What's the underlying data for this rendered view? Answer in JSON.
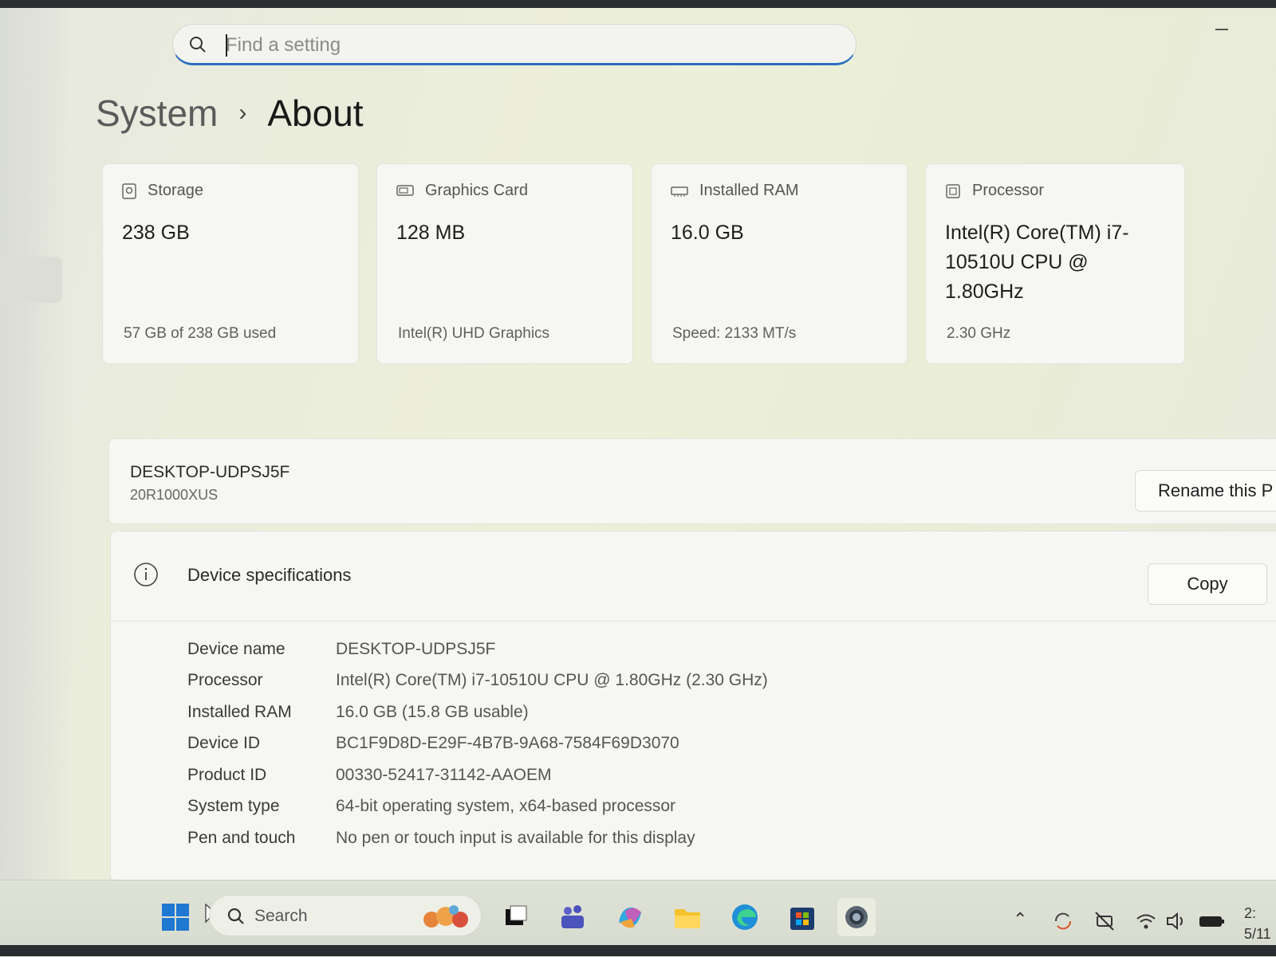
{
  "search": {
    "placeholder": "Find a setting"
  },
  "breadcrumb": {
    "parent": "System",
    "separator": "›",
    "current": "About"
  },
  "cards": [
    {
      "title": "Storage",
      "value": "238 GB",
      "sub": "57 GB of 238 GB used",
      "icon": "storage-icon"
    },
    {
      "title": "Graphics Card",
      "value": "128 MB",
      "sub": "Intel(R) UHD Graphics",
      "icon": "graphics-card-icon"
    },
    {
      "title": "Installed RAM",
      "value": "16.0 GB",
      "sub": "Speed: 2133 MT/s",
      "icon": "ram-icon"
    },
    {
      "title": "Processor",
      "value": "Intel(R) Core(TM) i7-10510U CPU @ 1.80GHz",
      "sub": "2.30 GHz",
      "icon": "processor-icon"
    }
  ],
  "device": {
    "name": "DESKTOP-UDPSJ5F",
    "model": "20R1000XUS",
    "rename_label": "Rename this P"
  },
  "specs": {
    "title": "Device specifications",
    "copy_label": "Copy",
    "rows": [
      {
        "key": "Device name",
        "value": "DESKTOP-UDPSJ5F"
      },
      {
        "key": "Processor",
        "value": "Intel(R) Core(TM) i7-10510U CPU @ 1.80GHz (2.30 GHz)"
      },
      {
        "key": "Installed RAM",
        "value": "16.0 GB (15.8 GB usable)"
      },
      {
        "key": "Device ID",
        "value": "BC1F9D8D-E29F-4B7B-9A68-7584F69D3070"
      },
      {
        "key": "Product ID",
        "value": "00330-52417-31142-AAOEM"
      },
      {
        "key": "System type",
        "value": "64-bit operating system, x64-based processor"
      },
      {
        "key": "Pen and touch",
        "value": "No pen or touch input is available for this display"
      }
    ]
  },
  "taskbar": {
    "search_label": "Search",
    "clock_time": "2:",
    "clock_date": "5/11"
  },
  "colors": {
    "accent": "#2a6fbf",
    "background": "#edf0d8",
    "card": "#f6f7f2"
  }
}
